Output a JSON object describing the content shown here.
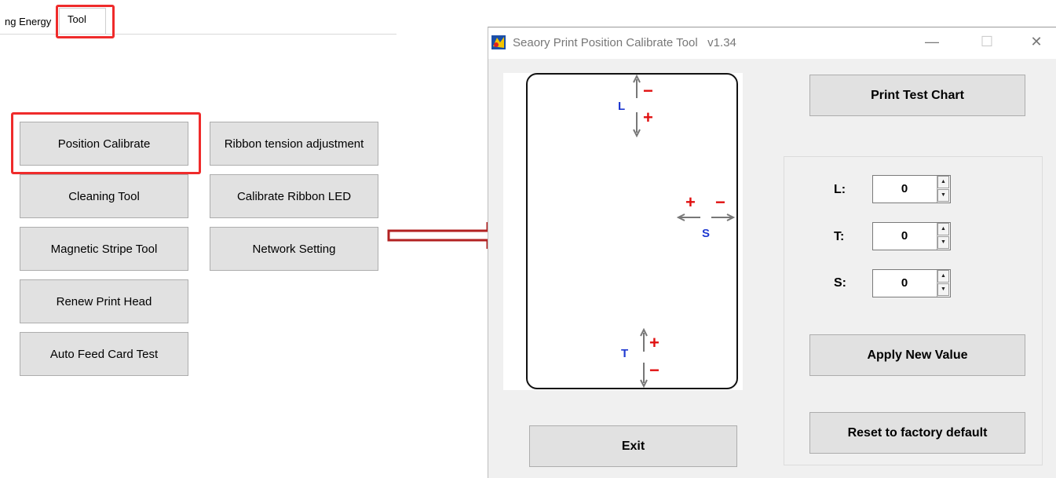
{
  "left_panel": {
    "tabs": {
      "previous_partial": "ng Energy",
      "active": "Tool"
    },
    "buttons": {
      "position_calibrate": "Position Calibrate",
      "cleaning_tool": "Cleaning Tool",
      "magnetic_stripe_tool": "Magnetic Stripe Tool",
      "renew_print_head": "Renew Print Head",
      "auto_feed_card_test": "Auto Feed Card Test",
      "ribbon_tension": "Ribbon tension adjustment",
      "calibrate_ribbon_led": "Calibrate Ribbon LED",
      "network_setting": "Network Setting"
    }
  },
  "dialog": {
    "title": "Seaory Print Position Calibrate Tool   v1.34",
    "window_controls": {
      "minimize": "—",
      "maximize": "☐",
      "close": "✕"
    },
    "card_diagram": {
      "L": "L",
      "T": "T",
      "S": "S",
      "plus": "+",
      "minus": "−"
    },
    "print_test_chart": "Print Test Chart",
    "fields": [
      {
        "label": "L:",
        "value": "0"
      },
      {
        "label": "T:",
        "value": "0"
      },
      {
        "label": "S:",
        "value": "0"
      }
    ],
    "apply_new_value": "Apply New Value",
    "reset_factory_default": "Reset to factory default",
    "exit": "Exit"
  },
  "colors": {
    "highlight": "#ef2b2b",
    "arrow": "#b22222",
    "label_blue": "#1f39d0",
    "sign_red": "#e01010"
  },
  "icons": [
    "arrow-right-icon",
    "app-icon",
    "spin-up-icon",
    "spin-down-icon"
  ]
}
